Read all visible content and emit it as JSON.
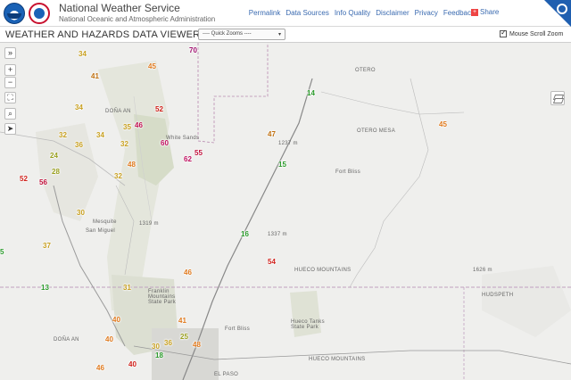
{
  "header": {
    "agency_name": "National Weather Service",
    "agency_subtitle": "National Oceanic and Atmospheric Administration",
    "nav": [
      "Permalink",
      "Data Sources",
      "Info Quality",
      "Disclaimer",
      "Privacy",
      "Feedback"
    ],
    "share_label": "Share"
  },
  "viewer": {
    "title": "WEATHER AND HAZARDS DATA VIEWER",
    "quick_zoom": "---- Quick Zooms ----",
    "mouse_scroll_label": "Mouse Scroll Zoom",
    "mouse_scroll_checked": true
  },
  "map": {
    "places": [
      {
        "id": "dona-ana-top",
        "text": "DOÑA AN"
      },
      {
        "id": "otero",
        "text": "OTERO"
      },
      {
        "id": "otero-mesa",
        "text": "OTERO MESA"
      },
      {
        "id": "hueco-mountains-1",
        "text": "HUECO MOUNTAINS"
      },
      {
        "id": "hueco-mountains-2",
        "text": "HUECO MOUNTAINS"
      },
      {
        "id": "hudspeth",
        "text": "HUDSPETH"
      },
      {
        "id": "dona-ana-bottom",
        "text": "DOÑA AN"
      },
      {
        "id": "el-paso",
        "text": "EL PASO"
      },
      {
        "id": "fort-bliss-1",
        "text": "Fort Bliss"
      },
      {
        "id": "fort-bliss-2",
        "text": "Fort Bliss"
      },
      {
        "id": "white-sands",
        "text": "White Sands"
      },
      {
        "id": "mesquite",
        "text": "Mesquite"
      },
      {
        "id": "san-miguel",
        "text": "San Miguel"
      },
      {
        "id": "franklin-mountains",
        "text": "Franklin Mountains State Park"
      },
      {
        "id": "hueco-tanks",
        "text": "Hueco Tanks State Park"
      },
      {
        "id": "elev-1237",
        "text": "1237 m"
      },
      {
        "id": "elev-1337",
        "text": "1337 m"
      },
      {
        "id": "elev-1319",
        "text": "1319 m"
      },
      {
        "id": "elev-1626",
        "text": "1626 m"
      }
    ],
    "stations": [
      {
        "value": "34",
        "color": "#c8a020"
      },
      {
        "value": "45",
        "color": "#e07a1e"
      },
      {
        "value": "70",
        "color": "#a01070"
      },
      {
        "value": "41",
        "color": "#c07010"
      },
      {
        "value": "14",
        "color": "#2a9a2a"
      },
      {
        "value": "34",
        "color": "#c8a020"
      },
      {
        "value": "52",
        "color": "#d0201a"
      },
      {
        "value": "45",
        "color": "#e07a1e"
      },
      {
        "value": "35",
        "color": "#c8a020"
      },
      {
        "value": "46",
        "color": "#c01050"
      },
      {
        "value": "32",
        "color": "#c8a020"
      },
      {
        "value": "34",
        "color": "#c8a020"
      },
      {
        "value": "47",
        "color": "#c07010"
      },
      {
        "value": "36",
        "color": "#c8a020"
      },
      {
        "value": "32",
        "color": "#c8a020"
      },
      {
        "value": "60",
        "color": "#c01060"
      },
      {
        "value": "55",
        "color": "#c0103a"
      },
      {
        "value": "62",
        "color": "#c01060"
      },
      {
        "value": "24",
        "color": "#9aa020"
      },
      {
        "value": "15",
        "color": "#2a9a2a"
      },
      {
        "value": "48",
        "color": "#e07a1e"
      },
      {
        "value": "28",
        "color": "#9aa020"
      },
      {
        "value": "32",
        "color": "#c8a020"
      },
      {
        "value": "52",
        "color": "#d0201a"
      },
      {
        "value": "56",
        "color": "#c0103a"
      },
      {
        "value": "30",
        "color": "#c8a020"
      },
      {
        "value": "16",
        "color": "#2a9a2a"
      },
      {
        "value": "37",
        "color": "#c8a020"
      },
      {
        "value": "54",
        "color": "#d0201a"
      },
      {
        "value": "46",
        "color": "#e07a1e"
      },
      {
        "value": "13",
        "color": "#2a9a2a"
      },
      {
        "value": "31",
        "color": "#c8a020"
      },
      {
        "value": "40",
        "color": "#e07a1e"
      },
      {
        "value": "40",
        "color": "#e07a1e"
      },
      {
        "value": "30",
        "color": "#c8a020"
      },
      {
        "value": "41",
        "color": "#e07a1e"
      },
      {
        "value": "36",
        "color": "#c8a020"
      },
      {
        "value": "18",
        "color": "#2a9a2a"
      },
      {
        "value": "46",
        "color": "#e07a1e"
      },
      {
        "value": "25",
        "color": "#9aa020"
      },
      {
        "value": "48",
        "color": "#e07a1e"
      },
      {
        "value": "40",
        "color": "#d0201a"
      },
      {
        "value": "5",
        "color": "#2a9a2a"
      }
    ]
  },
  "colors": {
    "link": "#3a6ab0",
    "brand_blue": "#1f5fb0"
  }
}
